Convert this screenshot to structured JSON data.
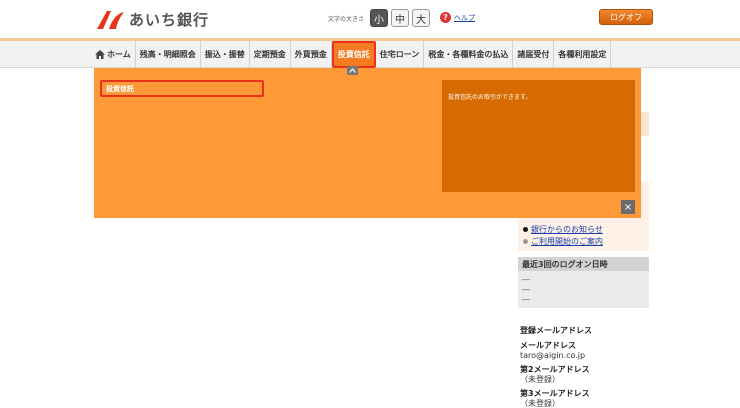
{
  "header": {
    "bank_name": "あいち銀行",
    "font_size_label": "文字の大きさ",
    "font_sizes": [
      "小",
      "中",
      "大"
    ],
    "help_label": "ヘルプ",
    "logout_label": "ログオフ"
  },
  "nav": {
    "items": [
      {
        "label": "ホーム"
      },
      {
        "label": "残高・明細照会"
      },
      {
        "label": "振込・振替"
      },
      {
        "label": "定期預金"
      },
      {
        "label": "外貨預金"
      },
      {
        "label": "投資信託"
      },
      {
        "label": "住宅ローン"
      },
      {
        "label": "税金・各種料金の払込"
      },
      {
        "label": "諸届受付"
      },
      {
        "label": "各種利用設定"
      }
    ],
    "active_index": 5
  },
  "dropdown": {
    "submenu_item": "投資信託",
    "description": "投資信託のお取引ができます。"
  },
  "side": {
    "notices": [
      {
        "label": "銀行からのお知らせ"
      },
      {
        "label": "ご利用開始のご案内"
      }
    ],
    "login_history": {
      "title": "最近3回のログオン日時",
      "entries": [
        "―",
        "―",
        "―"
      ]
    },
    "mail": {
      "title": "登録メールアドレス",
      "fields": [
        {
          "label": "メールアドレス",
          "value": "taro@aigin.co.jp"
        },
        {
          "label": "第2メールアドレス",
          "value": "（未登録）"
        },
        {
          "label": "第3メールアドレス",
          "value": "（未登録）"
        }
      ]
    }
  },
  "colors": {
    "accent": "#f47b20",
    "dropdown_bg": "#fd9a37",
    "description_bg": "#d76a00",
    "highlight": "#e8321a"
  }
}
